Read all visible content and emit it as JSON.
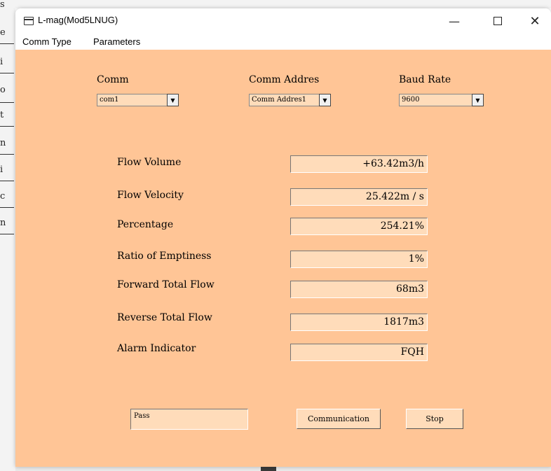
{
  "window": {
    "title": "L-mag(Mod5LNUG)",
    "controls": {
      "minimize": "—",
      "close": "✕"
    }
  },
  "menu": [
    {
      "label": "Comm Type"
    },
    {
      "label": "Parameters"
    }
  ],
  "settings": {
    "comm": {
      "label": "Comm",
      "value": "com1"
    },
    "comm_address": {
      "label": "Comm Addres",
      "value": "Comm Addres1"
    },
    "baud_rate": {
      "label": "Baud Rate",
      "value": "9600"
    }
  },
  "readings": [
    {
      "label": "Flow Volume",
      "value": "+63.42m3/h"
    },
    {
      "label": "Flow Velocity",
      "value": "25.422m / s"
    },
    {
      "label": "Percentage",
      "value": "254.21%"
    },
    {
      "label": "Ratio of Emptiness",
      "value": "1%"
    },
    {
      "label": "Forward Total Flow",
      "value": "68m3"
    },
    {
      "label": "Reverse Total Flow",
      "value": "1817m3"
    },
    {
      "label": "Alarm Indicator",
      "value": "FQH"
    }
  ],
  "status": {
    "value": "Pass"
  },
  "buttons": {
    "communication": "Communication",
    "stop": "Stop"
  },
  "colors": {
    "client_bg": "#ffc596",
    "field_bg": "#ffdcba"
  }
}
